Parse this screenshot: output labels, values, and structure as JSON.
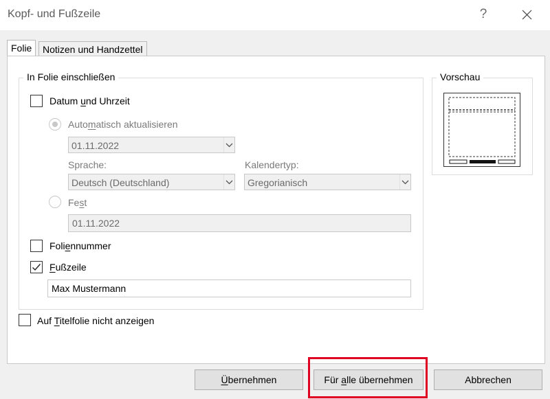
{
  "window": {
    "title": "Kopf- und Fußzeile",
    "help_label": "?"
  },
  "tabs": [
    {
      "label": "Folie",
      "active": true
    },
    {
      "label": "Notizen und Handzettel",
      "active": false
    }
  ],
  "include_group": {
    "legend": "In Folie einschließen",
    "date_time": {
      "pre": "Datum ",
      "ul": "u",
      "post": "nd Uhrzeit",
      "checked": false
    },
    "auto_update": {
      "pre": "Auto",
      "ul": "m",
      "post": "atisch aktualisieren",
      "selected": true,
      "enabled": false
    },
    "date_select_value": "01.11.2022",
    "language_label": "Sprache:",
    "language_value": "Deutsch (Deutschland)",
    "calendar_label": "Kalendertyp:",
    "calendar_value": "Gregorianisch",
    "fixed": {
      "pre": "Fe",
      "ul": "s",
      "post": "t",
      "selected": false,
      "enabled": false
    },
    "fixed_value": "01.11.2022",
    "slide_number": {
      "pre": "Foli",
      "ul": "e",
      "post": "nnummer",
      "checked": false
    },
    "footer": {
      "pre": "",
      "ul": "F",
      "post": "ußzeile",
      "checked": true
    },
    "footer_text": "Max Mustermann"
  },
  "title_slide": {
    "pre": "Auf ",
    "ul": "T",
    "post": "itelfolie nicht anzeigen",
    "checked": false
  },
  "preview": {
    "legend": "Vorschau"
  },
  "buttons": {
    "apply": {
      "pre": "",
      "ul": "Ü",
      "post": "bernehmen"
    },
    "apply_all": {
      "pre": "Für ",
      "ul": "a",
      "post": "lle übernehmen"
    },
    "cancel": "Abbrechen"
  },
  "colors": {
    "highlight": "#e00022",
    "window_bg": "#f0f0f0",
    "panel_bg": "#ffffff"
  }
}
